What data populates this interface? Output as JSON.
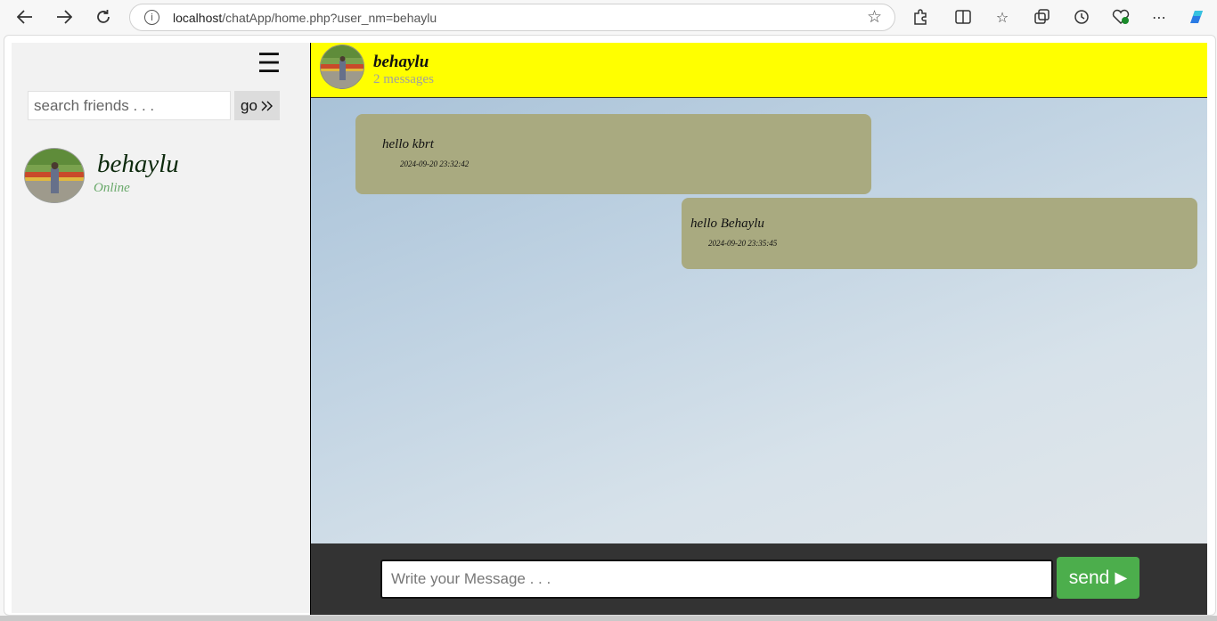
{
  "browser": {
    "url_host": "localhost",
    "url_path": "/chatApp/home.php?user_nm=behaylu"
  },
  "sidebar": {
    "search": {
      "placeholder": "search friends . . .",
      "go_label": "go"
    },
    "friends": [
      {
        "name": "behaylu",
        "status": "Online"
      }
    ]
  },
  "chat": {
    "header": {
      "name": "behaylu",
      "count": "2 messages"
    },
    "messages": [
      {
        "text": "hello kbrt",
        "time": "2024-09-20 23:32:42",
        "side": "received"
      },
      {
        "text": "hello Behaylu",
        "time": "2024-09-20 23:35:45",
        "side": "sent"
      }
    ],
    "composer": {
      "placeholder": "Write your Message . . .",
      "send_label": "send"
    }
  },
  "colors": {
    "header_bg": "#ffff00",
    "bubble_bg": "#a9aa80",
    "composer_bg": "#333333",
    "send_bg": "#4cae4c",
    "status_online": "#69a96a"
  },
  "icons": [
    "back-icon",
    "forward-icon",
    "reload-icon",
    "info-icon",
    "favorite-star-icon",
    "extensions-icon",
    "split-screen-icon",
    "favorites-icon",
    "collections-icon",
    "history-icon",
    "browser-essentials-icon",
    "more-icon",
    "copilot-icon",
    "hamburger-menu-icon",
    "double-chevron-icon",
    "play-arrow-icon"
  ]
}
